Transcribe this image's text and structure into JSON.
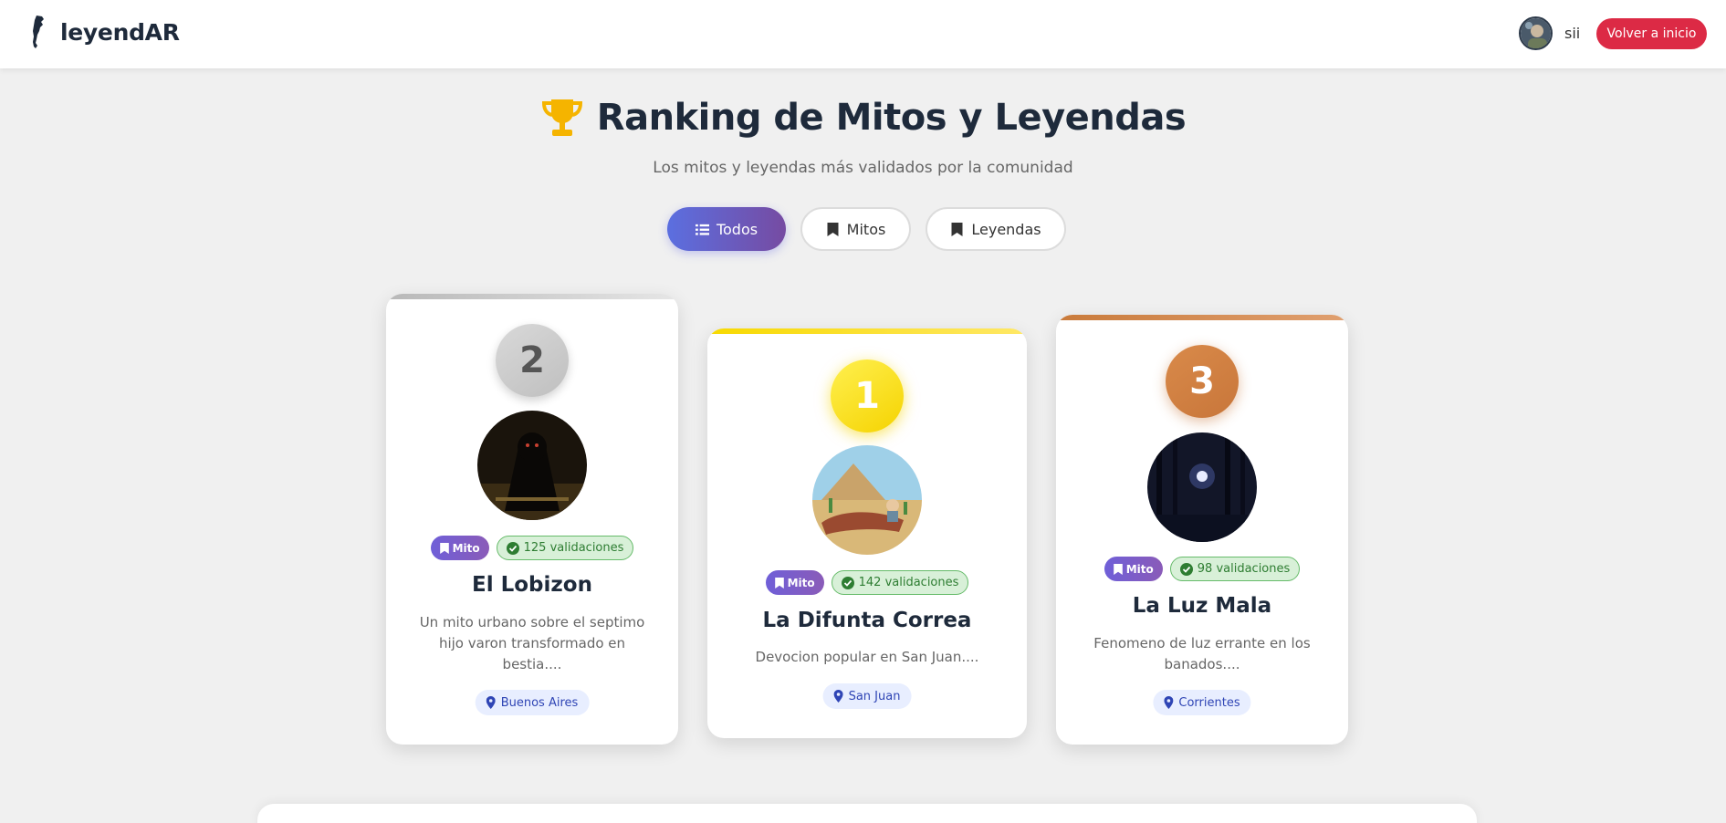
{
  "header": {
    "brand_name": "leyendAR",
    "user_name": "sii",
    "home_button_label": "Volver a inicio"
  },
  "page": {
    "title": "Ranking de Mitos y Leyendas",
    "subtitle": "Los mitos y leyendas más validados por la comunidad"
  },
  "filters": {
    "todos": "Todos",
    "mitos": "Mitos",
    "leyendas": "Leyendas",
    "active": "Todos"
  },
  "colors": {
    "primary_gradient_start": "#5b6fe0",
    "primary_gradient_end": "#764ba2",
    "home_button": "#dc2a45",
    "gold": "#f5d300",
    "silver": "#c8c8c8",
    "bronze": "#c8763a",
    "validation_green": "#2e7d32",
    "location_blue": "#2f45b5"
  },
  "ranking": [
    {
      "position": "2",
      "type": "Mito",
      "validations": "125 validaciones",
      "title": "El Lobizon",
      "description": "Un mito urbano sobre el septimo hijo varon transformado en bestia....",
      "location": "Buenos Aires"
    },
    {
      "position": "1",
      "type": "Mito",
      "validations": "142 validaciones",
      "title": "La Difunta Correa",
      "description": "Devocion popular en San Juan....",
      "location": "San Juan"
    },
    {
      "position": "3",
      "type": "Mito",
      "validations": "98 validaciones",
      "title": "La Luz Mala",
      "description": "Fenomeno de luz errante en los banados....",
      "location": "Corrientes"
    }
  ]
}
